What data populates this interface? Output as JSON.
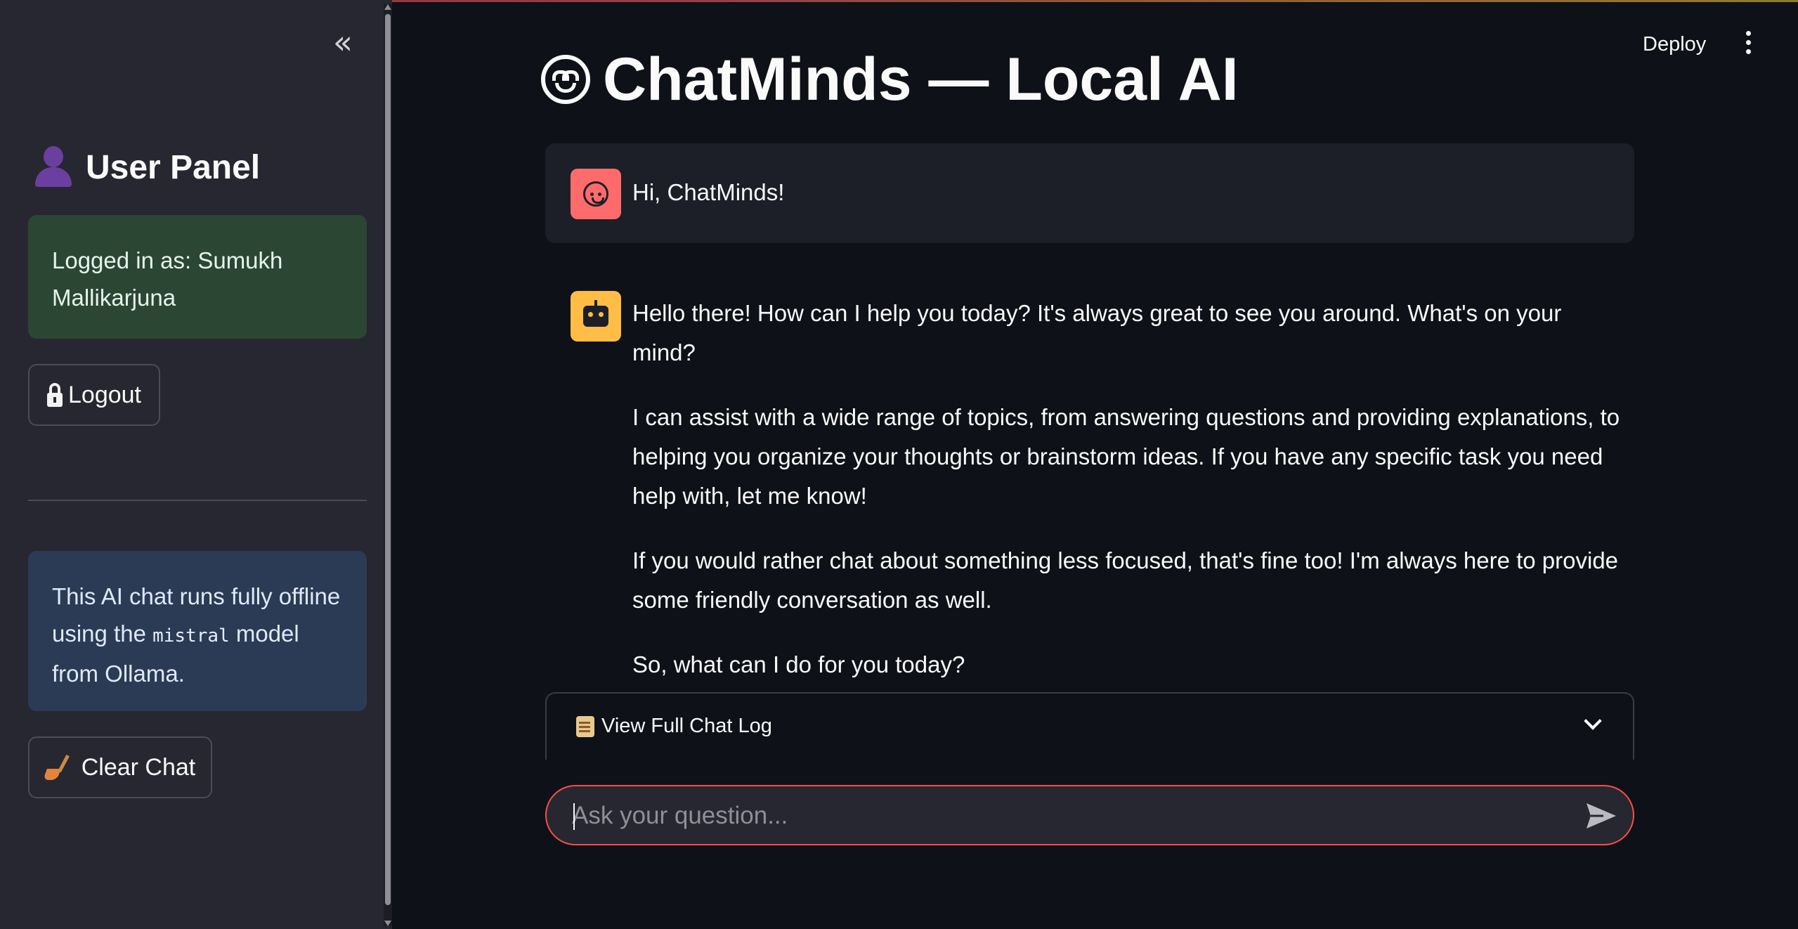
{
  "colors": {
    "app_bg": "#0e1117",
    "sidebar_bg": "#262730",
    "success_bg": "#2c4634",
    "info_bg": "#2b3b55",
    "accent": "#ff4b4b",
    "user_avatar": "#ff6b6b",
    "bot_avatar": "#ffbd45"
  },
  "header": {
    "deploy_label": "Deploy",
    "menu_icon": "vertical-dots-icon"
  },
  "sidebar": {
    "collapse_icon": "double-chevron-left-icon",
    "title_icon": "user-silhouette-icon",
    "title": "User Panel",
    "logged_in_text": "Logged in as: Sumukh Mallikarjuna",
    "logout_icon": "lock-icon",
    "logout_label": "Logout",
    "info_prefix": "This AI chat runs fully offline using the",
    "info_model": "mistral",
    "info_suffix": "model from Ollama.",
    "clear_icon": "broom-icon",
    "clear_label": "Clear Chat"
  },
  "main": {
    "title_icon": "robot-face-icon",
    "title": "ChatMinds — Local AI",
    "messages": [
      {
        "role": "user",
        "avatar_icon": "smiley-face-icon",
        "text": "Hi, ChatMinds!"
      },
      {
        "role": "assistant",
        "avatar_icon": "robot-icon",
        "paragraphs": [
          "Hello there! How can I help you today? It's always great to see you around. What's on your mind?",
          "I can assist with a wide range of topics, from answering questions and providing explanations, to helping you organize your thoughts or brainstorm ideas. If you have any specific task you need help with, let me know!",
          "If you would rather chat about something less focused, that's fine too! I'm always here to provide some friendly conversation as well.",
          "So, what can I do for you today?"
        ]
      }
    ],
    "expander": {
      "icon": "scroll-icon",
      "label": "View Full Chat Log",
      "expanded": false
    },
    "chat_input": {
      "placeholder": "Ask your question...",
      "value": "",
      "send_icon": "send-icon"
    }
  }
}
